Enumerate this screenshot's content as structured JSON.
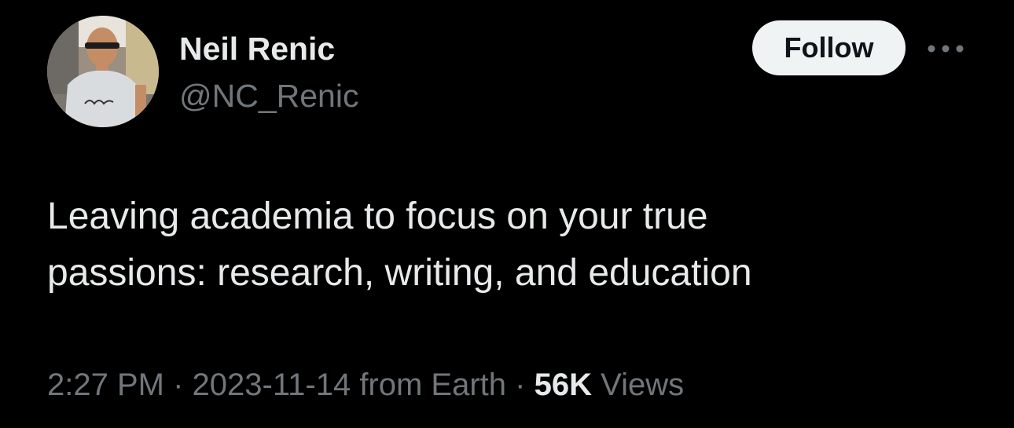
{
  "author": {
    "display_name": "Neil Renic",
    "handle": "@NC_Renic",
    "avatar_icon": "profile-photo"
  },
  "actions": {
    "follow_label": "Follow",
    "more_icon": "more-horizontal-icon"
  },
  "tweet": {
    "text": "Leaving academia to focus on your true\npassions: research, writing, and education"
  },
  "meta": {
    "time": "2:27 PM",
    "separator": "·",
    "date": "2023-11-14",
    "source": "from Earth",
    "views_count": "56K",
    "views_label": "Views"
  },
  "colors": {
    "background": "#000000",
    "primary_text": "#e7e9ea",
    "secondary_text": "#71767b",
    "button_bg": "#eff3f4",
    "button_text": "#0f1419"
  }
}
